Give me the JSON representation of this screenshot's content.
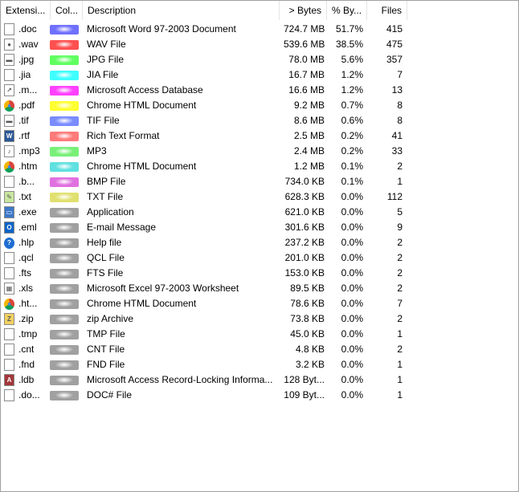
{
  "headers": {
    "extension": "Extensi...",
    "color": "Col...",
    "description": "Description",
    "bytes": "> Bytes",
    "percent": "% By...",
    "files": "Files"
  },
  "rows": [
    {
      "ext": ".doc",
      "color": "#7070ff",
      "desc": "Microsoft Word 97-2003 Document",
      "bytes": "724.7 MB",
      "pct": "51.7%",
      "files": "415",
      "icon": "word-doc-icon",
      "icon_color": "#ffffff",
      "icon_glyph": ""
    },
    {
      "ext": ".wav",
      "color": "#ff5050",
      "desc": "WAV File",
      "bytes": "539.6 MB",
      "pct": "38.5%",
      "files": "475",
      "icon": "audio-file-icon",
      "icon_color": "#ffffff",
      "icon_glyph": "●"
    },
    {
      "ext": ".jpg",
      "color": "#60ff60",
      "desc": "JPG File",
      "bytes": "78.0 MB",
      "pct": "5.6%",
      "files": "357",
      "icon": "image-file-icon",
      "icon_color": "#ffffff",
      "icon_glyph": "▬"
    },
    {
      "ext": ".jia",
      "color": "#40ffff",
      "desc": "JIA File",
      "bytes": "16.7 MB",
      "pct": "1.2%",
      "files": "7",
      "icon": "generic-file-icon",
      "icon_color": "#ffffff",
      "icon_glyph": ""
    },
    {
      "ext": ".m...",
      "color": "#ff40ff",
      "desc": "Microsoft Access Database",
      "bytes": "16.6 MB",
      "pct": "1.2%",
      "files": "13",
      "icon": "shortcut-file-icon",
      "icon_color": "#ffffff",
      "icon_glyph": "↗"
    },
    {
      "ext": ".pdf",
      "color": "#ffff30",
      "desc": "Chrome HTML Document",
      "bytes": "9.2 MB",
      "pct": "0.7%",
      "files": "8",
      "icon": "chrome-icon",
      "icon_color": "#dd4b39",
      "icon_glyph": "●"
    },
    {
      "ext": ".tif",
      "color": "#7a8cff",
      "desc": "TIF File",
      "bytes": "8.6 MB",
      "pct": "0.6%",
      "files": "8",
      "icon": "image-file-icon",
      "icon_color": "#ffffff",
      "icon_glyph": "▬"
    },
    {
      "ext": ".rtf",
      "color": "#ff7a7a",
      "desc": "Rich Text Format",
      "bytes": "2.5 MB",
      "pct": "0.2%",
      "files": "41",
      "icon": "wordpad-icon",
      "icon_color": "#2b5797",
      "icon_glyph": "W"
    },
    {
      "ext": ".mp3",
      "color": "#78f078",
      "desc": "MP3",
      "bytes": "2.4 MB",
      "pct": "0.2%",
      "files": "33",
      "icon": "audio-file-icon",
      "icon_color": "#ffffff",
      "icon_glyph": "♪"
    },
    {
      "ext": ".htm",
      "color": "#60e0e0",
      "desc": "Chrome HTML Document",
      "bytes": "1.2 MB",
      "pct": "0.1%",
      "files": "2",
      "icon": "chrome-icon",
      "icon_color": "#dd4b39",
      "icon_glyph": "●"
    },
    {
      "ext": ".b...",
      "color": "#e070e0",
      "desc": "BMP File",
      "bytes": "734.0 KB",
      "pct": "0.1%",
      "files": "1",
      "icon": "generic-file-icon",
      "icon_color": "#ffffff",
      "icon_glyph": ""
    },
    {
      "ext": ".txt",
      "color": "#e0e070",
      "desc": "TXT File",
      "bytes": "628.3 KB",
      "pct": "0.0%",
      "files": "112",
      "icon": "notepad-icon",
      "icon_color": "#c8e6a0",
      "icon_glyph": "✎"
    },
    {
      "ext": ".exe",
      "color": "#a0a0a0",
      "desc": "Application",
      "bytes": "621.0 KB",
      "pct": "0.0%",
      "files": "5",
      "icon": "application-icon",
      "icon_color": "#3c78c8",
      "icon_glyph": "▭"
    },
    {
      "ext": ".eml",
      "color": "#a0a0a0",
      "desc": "E-mail Message",
      "bytes": "301.6 KB",
      "pct": "0.0%",
      "files": "9",
      "icon": "outlook-icon",
      "icon_color": "#0a64c8",
      "icon_glyph": "O"
    },
    {
      "ext": ".hlp",
      "color": "#a0a0a0",
      "desc": "Help file",
      "bytes": "237.2 KB",
      "pct": "0.0%",
      "files": "2",
      "icon": "help-icon",
      "icon_color": "#1e6ed2",
      "icon_glyph": "?"
    },
    {
      "ext": ".qcl",
      "color": "#a0a0a0",
      "desc": "QCL File",
      "bytes": "201.0 KB",
      "pct": "0.0%",
      "files": "2",
      "icon": "generic-file-icon",
      "icon_color": "#ffffff",
      "icon_glyph": ""
    },
    {
      "ext": ".fts",
      "color": "#a0a0a0",
      "desc": "FTS File",
      "bytes": "153.0 KB",
      "pct": "0.0%",
      "files": "2",
      "icon": "generic-file-icon",
      "icon_color": "#ffffff",
      "icon_glyph": ""
    },
    {
      "ext": ".xls",
      "color": "#a0a0a0",
      "desc": "Microsoft Excel 97-2003 Worksheet",
      "bytes": "89.5 KB",
      "pct": "0.0%",
      "files": "2",
      "icon": "spreadsheet-icon",
      "icon_color": "#ffffff",
      "icon_glyph": "▦"
    },
    {
      "ext": ".ht...",
      "color": "#a0a0a0",
      "desc": "Chrome HTML Document",
      "bytes": "78.6 KB",
      "pct": "0.0%",
      "files": "7",
      "icon": "chrome-icon",
      "icon_color": "#dd4b39",
      "icon_glyph": "●"
    },
    {
      "ext": ".zip",
      "color": "#a0a0a0",
      "desc": "zip Archive",
      "bytes": "73.8 KB",
      "pct": "0.0%",
      "files": "2",
      "icon": "zip-icon",
      "icon_color": "#f0d060",
      "icon_glyph": "Z"
    },
    {
      "ext": ".tmp",
      "color": "#a0a0a0",
      "desc": "TMP File",
      "bytes": "45.0 KB",
      "pct": "0.0%",
      "files": "1",
      "icon": "generic-file-icon",
      "icon_color": "#ffffff",
      "icon_glyph": ""
    },
    {
      "ext": ".cnt",
      "color": "#a0a0a0",
      "desc": "CNT File",
      "bytes": "4.8 KB",
      "pct": "0.0%",
      "files": "2",
      "icon": "generic-file-icon",
      "icon_color": "#ffffff",
      "icon_glyph": ""
    },
    {
      "ext": ".fnd",
      "color": "#a0a0a0",
      "desc": "FND File",
      "bytes": "3.2 KB",
      "pct": "0.0%",
      "files": "1",
      "icon": "generic-file-icon",
      "icon_color": "#ffffff",
      "icon_glyph": ""
    },
    {
      "ext": ".ldb",
      "color": "#a0a0a0",
      "desc": "Microsoft Access Record-Locking Informa...",
      "bytes": "128 Byt...",
      "pct": "0.0%",
      "files": "1",
      "icon": "access-lock-icon",
      "icon_color": "#a4373a",
      "icon_glyph": "A"
    },
    {
      "ext": ".do...",
      "color": "#a0a0a0",
      "desc": "DOC# File",
      "bytes": "109 Byt...",
      "pct": "0.0%",
      "files": "1",
      "icon": "generic-file-icon",
      "icon_color": "#ffffff",
      "icon_glyph": ""
    }
  ]
}
